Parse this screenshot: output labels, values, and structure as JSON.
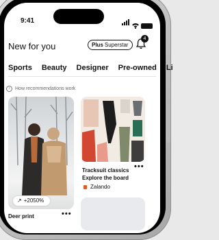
{
  "status_bar": {
    "time": "9:41"
  },
  "header": {
    "title": "New for you",
    "plus_label": "Plus",
    "plus_tier": "Superstar",
    "notification_count": "4"
  },
  "tabs": [
    "Sports",
    "Beauty",
    "Designer",
    "Pre-owned",
    "Li"
  ],
  "info_text": "How recommendations work",
  "cards": {
    "left": {
      "growth": "+2050%",
      "caption": "Deer print"
    },
    "right": {
      "title_line1": "Tracksuit classics",
      "title_line2": "Explore the board",
      "brand": "Zalando"
    }
  },
  "colors": {
    "brand_logo": "#e25a1c"
  },
  "icons": [
    "wifi-icon",
    "battery-icon",
    "bell-icon",
    "trend-up-icon",
    "info-icon",
    "more-icon"
  ]
}
